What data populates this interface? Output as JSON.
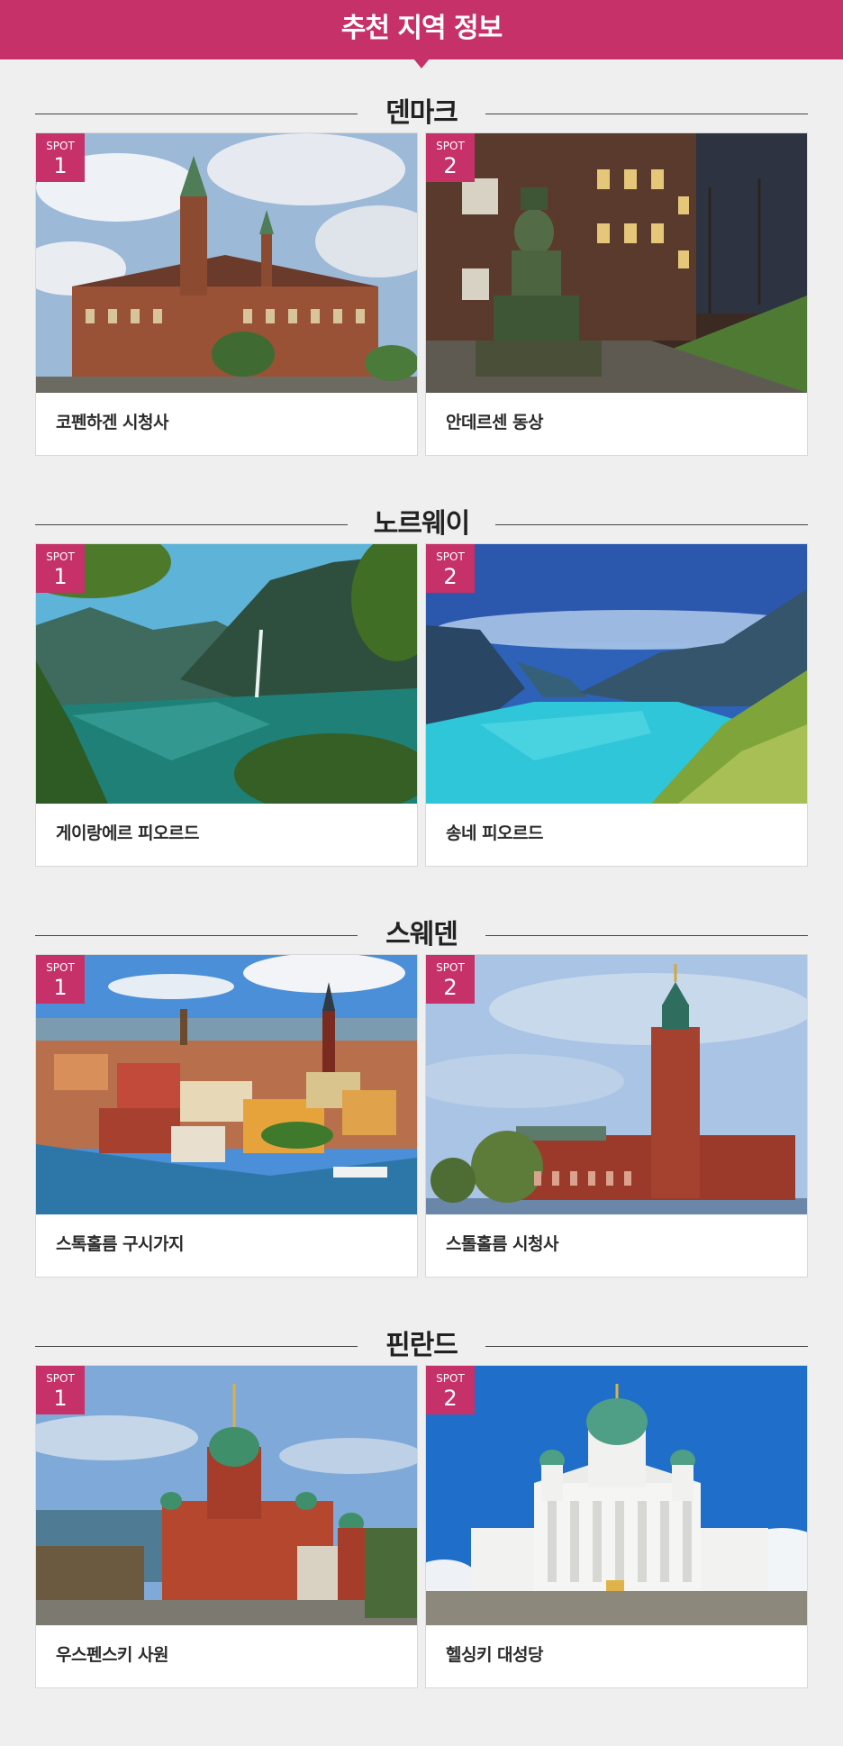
{
  "header": {
    "title": "추천 지역 정보"
  },
  "badge_label": "SPOT",
  "sections": [
    {
      "country": "덴마크",
      "spots": [
        {
          "number": "1",
          "name": "코펜하겐 시청사"
        },
        {
          "number": "2",
          "name": "안데르센 동상"
        }
      ]
    },
    {
      "country": "노르웨이",
      "spots": [
        {
          "number": "1",
          "name": "게이랑에르 피오르드"
        },
        {
          "number": "2",
          "name": "송네 피오르드"
        }
      ]
    },
    {
      "country": "스웨덴",
      "spots": [
        {
          "number": "1",
          "name": "스톡홀름 구시가지"
        },
        {
          "number": "2",
          "name": "스톨홀름 시청사"
        }
      ]
    },
    {
      "country": "핀란드",
      "spots": [
        {
          "number": "1",
          "name": "우스펜스키 사원"
        },
        {
          "number": "2",
          "name": "헬싱키 대성당"
        }
      ]
    }
  ],
  "colors": {
    "accent": "#c53168",
    "background": "#efeff0"
  }
}
